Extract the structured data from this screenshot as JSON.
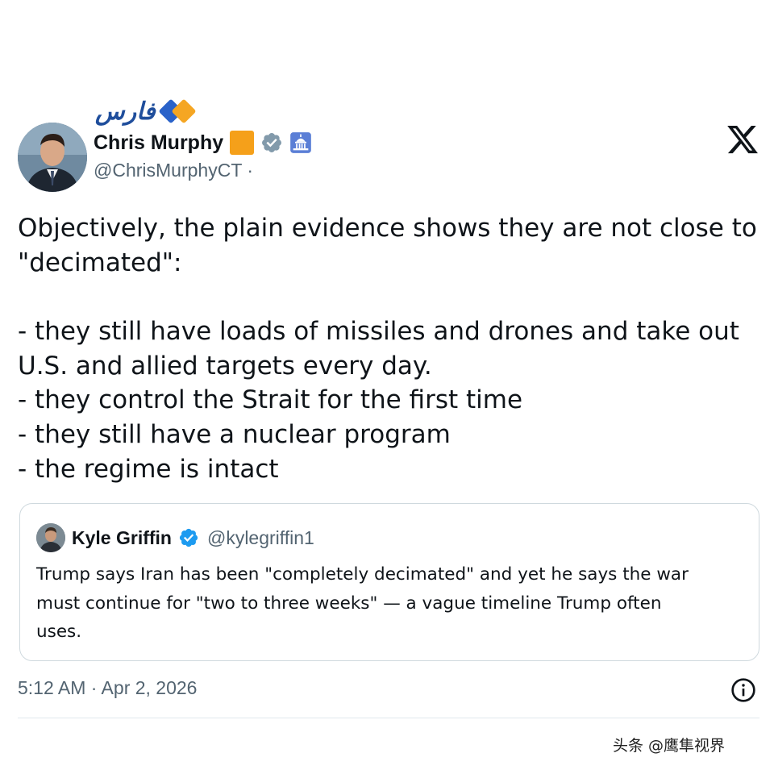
{
  "source_logo": {
    "text": "فارس",
    "colors": {
      "text": "#1f4e9c",
      "diamond_blue": "#2a62c9",
      "diamond_orange": "#f5a623"
    }
  },
  "tweet": {
    "author_name": "Chris Murphy",
    "author_handle": "@ChrisMurphyCT ·",
    "badges": [
      "orange-square-badge",
      "verified-gray-icon",
      "capitol-icon"
    ],
    "platform_icon": "x-logo-icon",
    "body_lines": [
      "Objectively, the plain evidence shows they are not close to",
      "\"decimated\":",
      "",
      "- they still have loads of missiles and drones and take out",
      "U.S. and allied targets every day.",
      "- they control the Strait for the first time",
      "- they still have a nuclear program",
      "- the regime is intact"
    ],
    "timestamp": "5:12 AM · Apr 2, 2026",
    "info_icon": "info-icon"
  },
  "quoted_tweet": {
    "author_name": "Kyle Griffin",
    "author_handle": "@kylegriffin1",
    "verified": true,
    "text_lines": [
      "Trump says Iran has been \"completely decimated\" and yet he says the war",
      "must continue for \"two to three weeks\" — a vague timeline Trump often",
      "uses."
    ]
  },
  "watermark": "头条 @鹰隼视界",
  "colors": {
    "text_primary": "#0f1419",
    "text_secondary": "#536471",
    "border": "#cfd9de",
    "verified_blue": "#1d9bf0",
    "verified_gray": "#829aab",
    "badge_orange": "#f5a01a"
  }
}
